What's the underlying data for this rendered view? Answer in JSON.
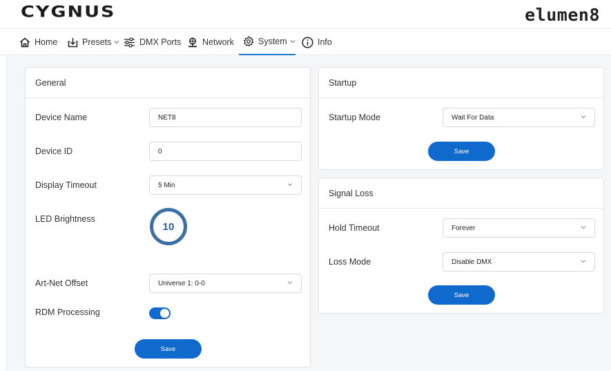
{
  "brand": {
    "left_logo": "CYGNUS",
    "right_logo": "elumen8"
  },
  "nav": {
    "home": "Home",
    "presets": "Presets",
    "dmx_ports": "DMX Ports",
    "network": "Network",
    "system": "System",
    "info": "Info",
    "active": "System"
  },
  "general": {
    "title": "General",
    "device_name_label": "Device Name",
    "device_name_value": "NET8",
    "device_id_label": "Device ID",
    "device_id_value": "0",
    "display_timeout_label": "Display Timeout",
    "display_timeout_value": "5 Min",
    "led_brightness_label": "LED Brightness",
    "led_brightness_value": "10",
    "artnet_offset_label": "Art-Net Offset",
    "artnet_offset_value": "Universe 1: 0-0",
    "rdm_processing_label": "RDM Processing",
    "rdm_processing_on": true,
    "save_label": "Save"
  },
  "startup": {
    "title": "Startup",
    "mode_label": "Startup Mode",
    "mode_value": "Wait For Data",
    "save_label": "Save"
  },
  "signal_loss": {
    "title": "Signal Loss",
    "hold_timeout_label": "Hold Timeout",
    "hold_timeout_value": "Forever",
    "loss_mode_label": "Loss Mode",
    "loss_mode_value": "Disable DMX",
    "save_label": "Save"
  },
  "colors": {
    "accent": "#1069cc",
    "knob": "#3d6fa6",
    "background": "#f5f6f7"
  }
}
